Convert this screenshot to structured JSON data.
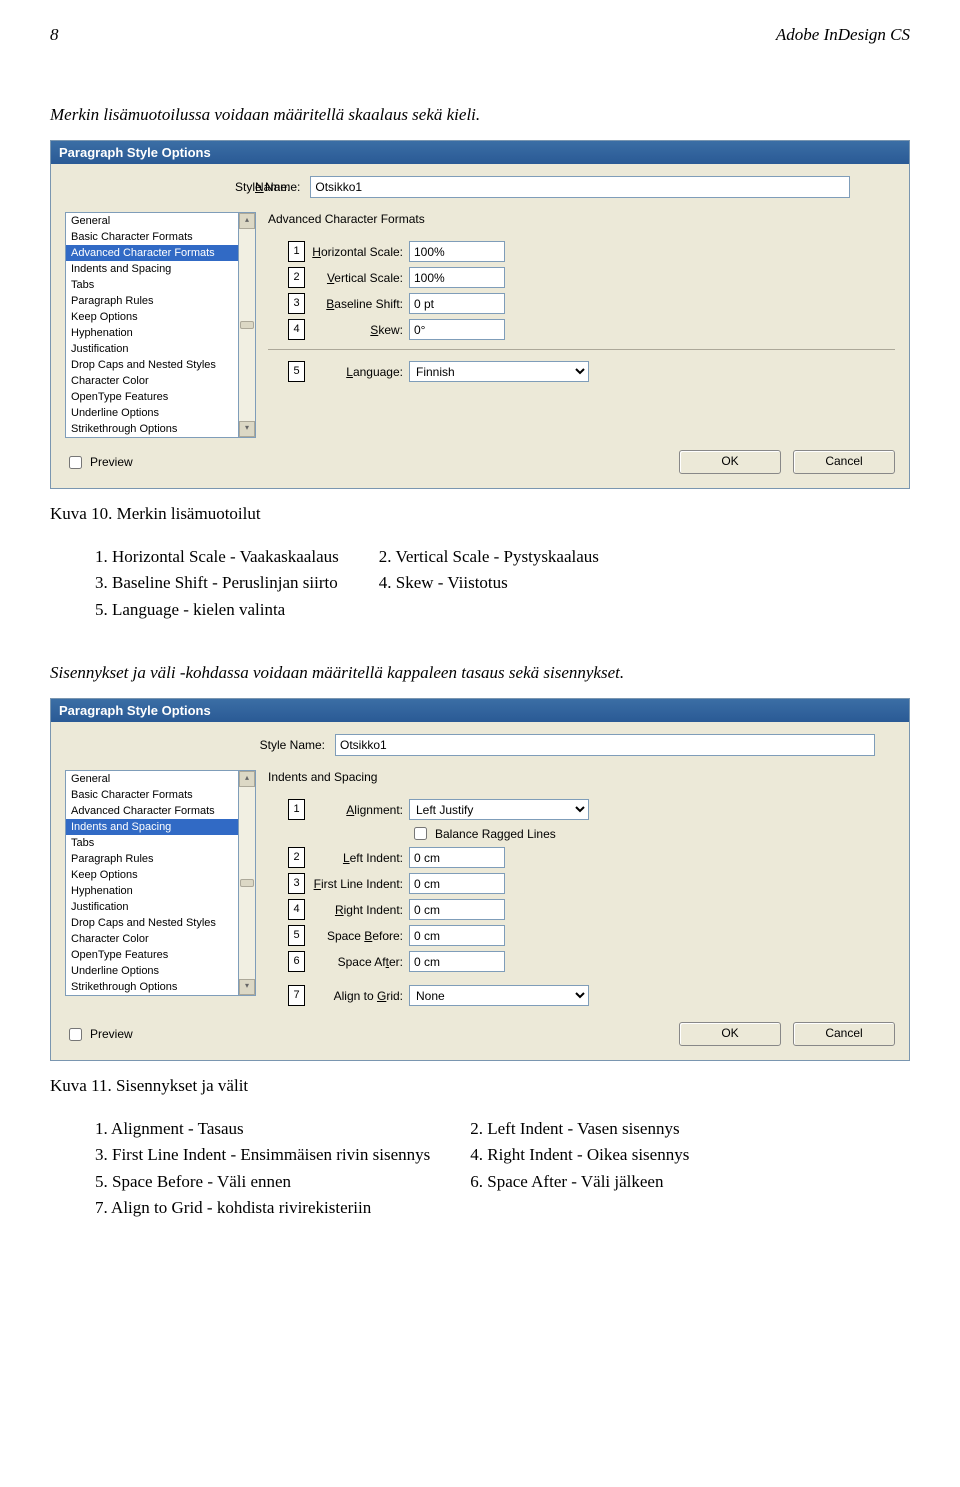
{
  "page_number": "8",
  "header_right": "Adobe InDesign CS",
  "intro1": "Merkin lisämuotoilussa voidaan määritellä skaalaus sekä kieli.",
  "intro2": "Sisennykset ja väli -kohdassa voidaan määritellä kappaleen tasaus sekä sisennykset.",
  "caption1": "Kuva 10. Merkin lisämuotoilut",
  "caption2": "Kuva 11. Sisennykset ja välit",
  "dialog1": {
    "title": "Paragraph Style Options",
    "style_name_label": "Style Name:",
    "style_name_value": "Otsikko1",
    "section": "Advanced Character Formats",
    "sidebar": {
      "items": [
        "General",
        "Basic Character Formats",
        "Advanced Character Formats",
        "Indents and Spacing",
        "Tabs",
        "Paragraph Rules",
        "Keep Options",
        "Hyphenation",
        "Justification",
        "Drop Caps and Nested Styles",
        "Character Color",
        "OpenType Features",
        "Underline Options",
        "Strikethrough Options"
      ],
      "selected_index": 2
    },
    "rows": [
      {
        "num": "1",
        "label": "Horizontal Scale:",
        "value": "100%"
      },
      {
        "num": "2",
        "label": "Vertical Scale:",
        "value": "100%"
      },
      {
        "num": "3",
        "label": "Baseline Shift:",
        "value": "0 pt"
      },
      {
        "num": "4",
        "label": "Skew:",
        "value": "0°"
      }
    ],
    "lang_row": {
      "num": "5",
      "label": "Language:",
      "value": "Finnish"
    },
    "preview_label": "Preview",
    "ok": "OK",
    "cancel": "Cancel"
  },
  "dialog2": {
    "title": "Paragraph Style Options",
    "style_name_label": "Style Name:",
    "style_name_value": "Otsikko1",
    "section": "Indents and Spacing",
    "sidebar": {
      "items": [
        "General",
        "Basic Character Formats",
        "Advanced Character Formats",
        "Indents and Spacing",
        "Tabs",
        "Paragraph Rules",
        "Keep Options",
        "Hyphenation",
        "Justification",
        "Drop Caps and Nested Styles",
        "Character Color",
        "OpenType Features",
        "Underline Options",
        "Strikethrough Options"
      ],
      "selected_index": 3
    },
    "alignment_row": {
      "num": "1",
      "label": "Alignment:",
      "value": "Left Justify"
    },
    "balance_label": "Balance Ragged Lines",
    "rows": [
      {
        "num": "2",
        "label": "Left Indent:",
        "value": "0 cm"
      },
      {
        "num": "3",
        "label": "First Line Indent:",
        "value": "0 cm"
      },
      {
        "num": "4",
        "label": "Right Indent:",
        "value": "0 cm"
      },
      {
        "num": "5",
        "label": "Space Before:",
        "value": "0 cm"
      },
      {
        "num": "6",
        "label": "Space After:",
        "value": "0 cm"
      }
    ],
    "grid_row": {
      "num": "7",
      "label": "Align to Grid:",
      "value": "None"
    },
    "preview_label": "Preview",
    "ok": "OK",
    "cancel": "Cancel"
  },
  "list1": {
    "col1": [
      "1. Horizontal Scale - Vaakaskaalaus",
      "3. Baseline Shift - Peruslinjan siirto",
      "5. Language - kielen valinta"
    ],
    "col2": [
      "2. Vertical Scale - Pystyskaalaus",
      "4. Skew - Viistotus"
    ]
  },
  "list2": {
    "col1": [
      "1. Alignment - Tasaus",
      "3. First Line Indent - Ensimmäisen rivin sisennys",
      "5. Space Before - Väli ennen",
      "7. Align to Grid - kohdista rivirekisteriin"
    ],
    "col2": [
      "2. Left Indent - Vasen sisennys",
      "4. Right Indent - Oikea sisennys",
      "6. Space After - Väli jälkeen"
    ]
  }
}
